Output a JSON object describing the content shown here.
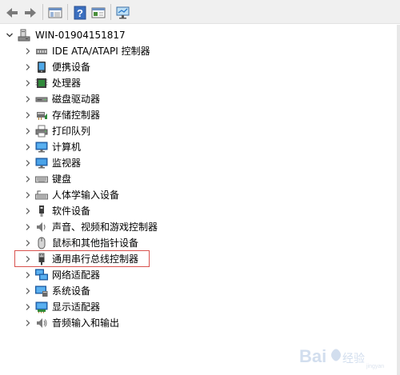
{
  "toolbar": {
    "buttons": [
      {
        "name": "back-icon"
      },
      {
        "name": "forward-icon"
      },
      {
        "name": "show-hide-console-tree-icon"
      },
      {
        "name": "help-icon"
      },
      {
        "name": "properties-icon"
      },
      {
        "name": "scan-hardware-changes-icon"
      }
    ]
  },
  "tree": {
    "root": {
      "label": "WIN-01904151817",
      "icon": "computer-icon",
      "expanded": true
    },
    "items": [
      {
        "label": "IDE ATA/ATAPI 控制器",
        "icon": "ide-controller-icon"
      },
      {
        "label": "便携设备",
        "icon": "portable-device-icon"
      },
      {
        "label": "处理器",
        "icon": "processor-icon"
      },
      {
        "label": "磁盘驱动器",
        "icon": "disk-drive-icon"
      },
      {
        "label": "存储控制器",
        "icon": "storage-controller-icon"
      },
      {
        "label": "打印队列",
        "icon": "printer-icon"
      },
      {
        "label": "计算机",
        "icon": "computer-monitor-icon"
      },
      {
        "label": "监视器",
        "icon": "monitor-icon"
      },
      {
        "label": "键盘",
        "icon": "keyboard-icon"
      },
      {
        "label": "人体学输入设备",
        "icon": "hid-icon"
      },
      {
        "label": "软件设备",
        "icon": "software-device-icon"
      },
      {
        "label": "声音、视频和游戏控制器",
        "icon": "speaker-icon"
      },
      {
        "label": "鼠标和其他指针设备",
        "icon": "mouse-icon"
      },
      {
        "label": "通用串行总线控制器",
        "icon": "usb-icon",
        "highlighted": true
      },
      {
        "label": "网络适配器",
        "icon": "network-adapter-icon"
      },
      {
        "label": "系统设备",
        "icon": "system-device-icon"
      },
      {
        "label": "显示适配器",
        "icon": "display-adapter-icon"
      },
      {
        "label": "音频输入和输出",
        "icon": "audio-io-icon"
      }
    ]
  },
  "colors": {
    "highlight_border": "#d9534f",
    "toolbar_bg": "#f0f0f0",
    "icon_blue": "#2a77c9"
  }
}
